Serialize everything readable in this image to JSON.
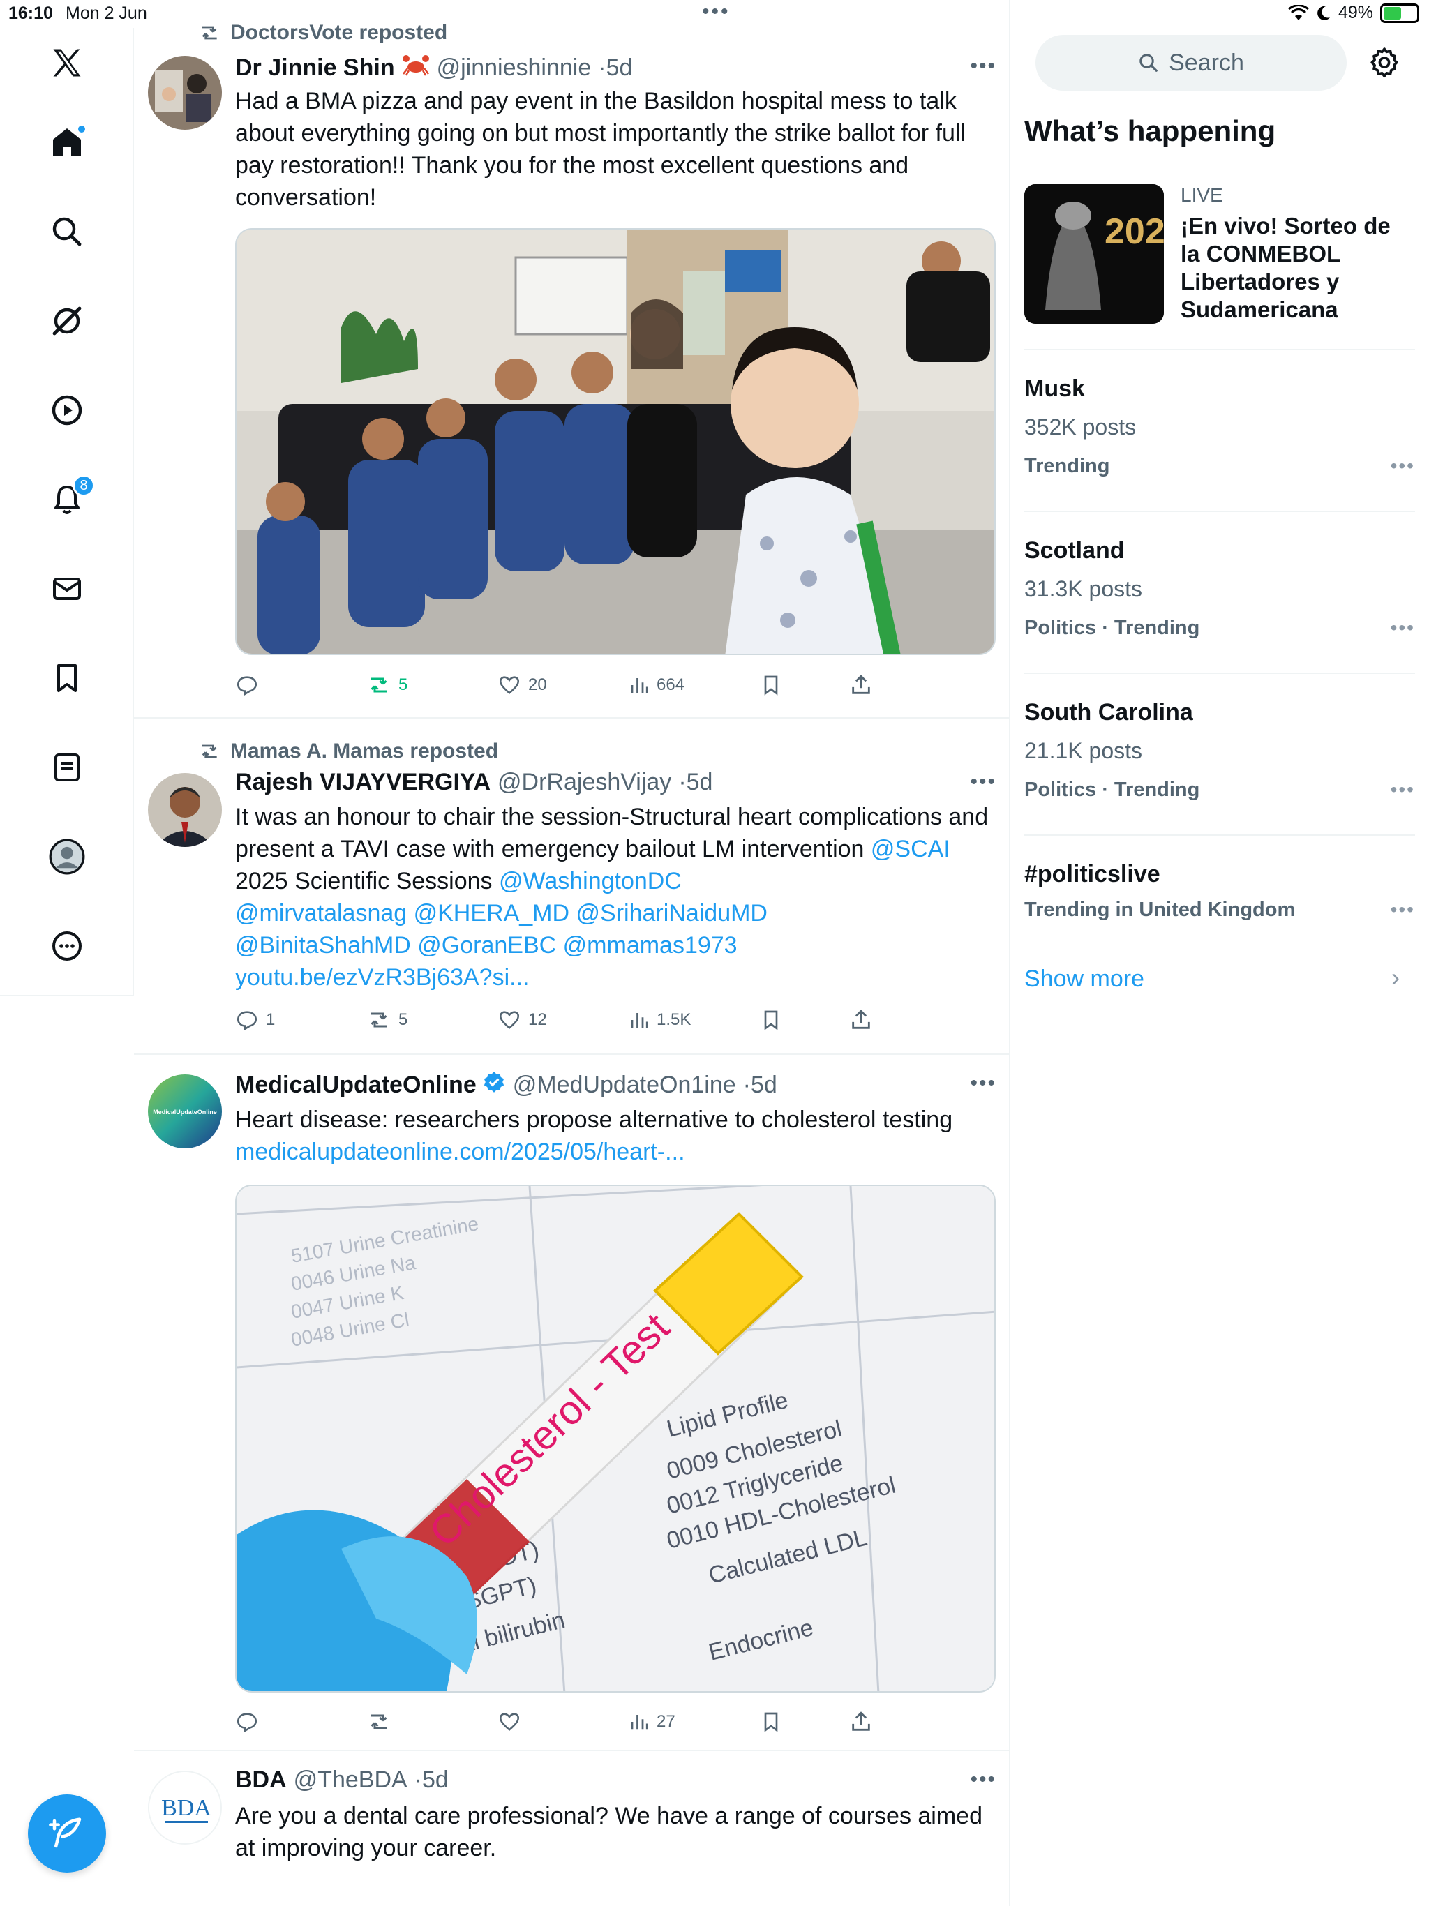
{
  "status_bar": {
    "time": "16:10",
    "date": "Mon 2 Jun",
    "battery": "49%",
    "battery_level": 0.49
  },
  "nav": {
    "notifications_badge": "8"
  },
  "posts": [
    {
      "repost_by": "DoctorsVote reposted",
      "name": "Dr Jinnie Shin",
      "handle": "@jinnieshinnie",
      "time": "5d",
      "text": "Had a BMA pizza and pay event in the Basildon hospital mess to talk about everything going on but most importantly the strike ballot for full pay restoration!! Thank you for the most excellent questions and conversation!",
      "replies": "",
      "reposts": "5",
      "likes": "20",
      "views": "664"
    },
    {
      "repost_by": "Mamas A. Mamas reposted",
      "name": "Rajesh VIJAYVERGIYA",
      "handle": "@DrRajeshVijay",
      "time": "5d",
      "text_1": "It was an honour to chair the session-Structural heart complications and present a TAVI case with emergency bailout LM intervention ",
      "mention_scai": "@SCAI",
      "text_2": " 2025 Scientific Sessions ",
      "mention_dc": "@WashingtonDC",
      "mentions_line": "@mirvatalasnag @KHERA_MD @SrihariNaiduMD",
      "mentions_line_2": "@BinitaShahMD @GoranEBC @mmamas1973",
      "url": "youtu.be/ezVzR3Bj63A?si...",
      "replies": "1",
      "reposts": "5",
      "likes": "12",
      "views": "1.5K"
    },
    {
      "name": "MedicalUpdateOnline",
      "handle": "@MedUpdateOn1ine",
      "time": "5d",
      "text": "Heart disease: researchers propose alternative to cholesterol testing",
      "url": "medicalupdateonline.com/2025/05/heart-...",
      "avatar_text": "MedicalUpdateOnline",
      "image_text": "Cholesterol - Test",
      "replies": "",
      "reposts": "",
      "likes": "",
      "views": "27"
    },
    {
      "name": "BDA",
      "handle": "@TheBDA",
      "time": "5d",
      "avatar_text": "BDA",
      "text": "Are you a dental care professional? We have a range of courses aimed at improving your career."
    }
  ],
  "search": {
    "placeholder": "Search"
  },
  "whats_happening": {
    "title": "What’s happening",
    "live": {
      "label": "LIVE",
      "title": "¡En vivo! Sorteo de la CONMEBOL Libertadores y Sudamericana",
      "thumb_text": "202"
    },
    "trends": [
      {
        "name": "Musk",
        "posts": "352K posts",
        "category": "Trending"
      },
      {
        "name": "Scotland",
        "posts": "31.3K posts",
        "category": "Politics · Trending"
      },
      {
        "name": "South Carolina",
        "posts": "21.1K posts",
        "category": "Politics · Trending"
      },
      {
        "name": "#politicslive",
        "posts": "",
        "category": "Trending in United Kingdom"
      }
    ],
    "show_more": "Show more"
  },
  "colors": {
    "accent": "#1d9bf0",
    "repost_active": "#00ba7c",
    "muted": "#536471",
    "border": "#eff3f4"
  }
}
